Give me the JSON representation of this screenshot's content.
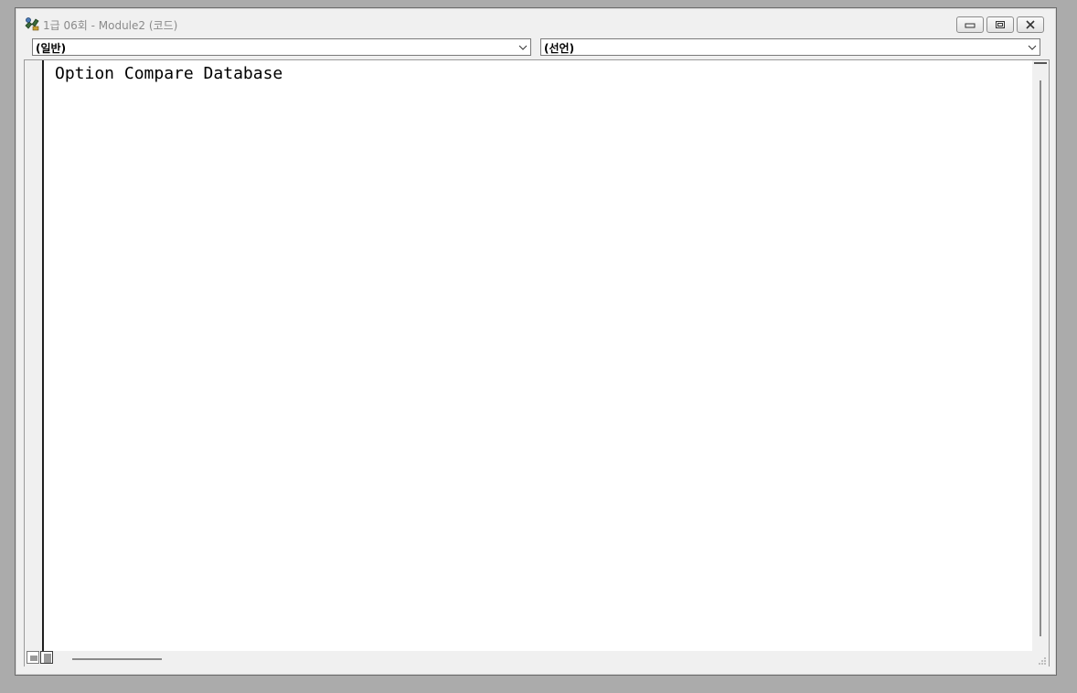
{
  "window": {
    "title": "1급 06회 - Module2 (코드)",
    "icon": "vba-module-icon",
    "buttons": {
      "minimize_icon": "minimize-icon",
      "restore_icon": "restore-icon",
      "close_icon": "close-icon"
    }
  },
  "combos": {
    "object": {
      "value": "(일반)"
    },
    "procedure": {
      "value": "(선언)"
    }
  },
  "editor": {
    "lines": [
      "Option Compare Database"
    ]
  },
  "colors": {
    "background": "#ababab",
    "window": "#f0f0f0",
    "editor": "#ffffff",
    "text": "#000000"
  }
}
